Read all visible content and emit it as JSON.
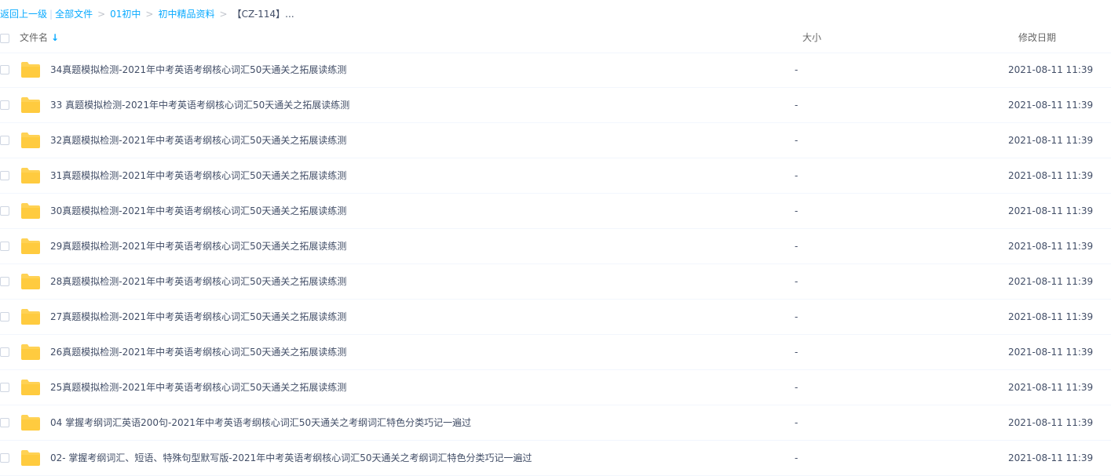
{
  "breadcrumb": {
    "back": "返回上一级",
    "bar": "|",
    "items": [
      "全部文件",
      "01初中",
      "初中精品资料"
    ],
    "gt": ">",
    "current": "【CZ-114】..."
  },
  "header": {
    "name": "文件名",
    "sort_icon": "↓",
    "size": "大小",
    "date": "修改日期"
  },
  "icons": {
    "folder": "folder-icon",
    "folder_color": "#ffd255"
  },
  "files": [
    {
      "name": "34真题模拟检测-2021年中考英语考纲核心词汇50天通关之拓展读练测",
      "size": "-",
      "date": "2021-08-11 11:39"
    },
    {
      "name": "33 真题模拟检测-2021年中考英语考纲核心词汇50天通关之拓展读练测",
      "size": "-",
      "date": "2021-08-11 11:39"
    },
    {
      "name": "32真题模拟检测-2021年中考英语考纲核心词汇50天通关之拓展读练测",
      "size": "-",
      "date": "2021-08-11 11:39"
    },
    {
      "name": "31真题模拟检测-2021年中考英语考纲核心词汇50天通关之拓展读练测",
      "size": "-",
      "date": "2021-08-11 11:39"
    },
    {
      "name": "30真题模拟检测-2021年中考英语考纲核心词汇50天通关之拓展读练测",
      "size": "-",
      "date": "2021-08-11 11:39"
    },
    {
      "name": "29真题模拟检测-2021年中考英语考纲核心词汇50天通关之拓展读练测",
      "size": "-",
      "date": "2021-08-11 11:39"
    },
    {
      "name": "28真题模拟检测-2021年中考英语考纲核心词汇50天通关之拓展读练测",
      "size": "-",
      "date": "2021-08-11 11:39"
    },
    {
      "name": "27真题模拟检测-2021年中考英语考纲核心词汇50天通关之拓展读练测",
      "size": "-",
      "date": "2021-08-11 11:39"
    },
    {
      "name": "26真题模拟检测-2021年中考英语考纲核心词汇50天通关之拓展读练测",
      "size": "-",
      "date": "2021-08-11 11:39"
    },
    {
      "name": "25真题模拟检测-2021年中考英语考纲核心词汇50天通关之拓展读练测",
      "size": "-",
      "date": "2021-08-11 11:39"
    },
    {
      "name": "04 掌握考纲词汇英语200句-2021年中考英语考纲核心词汇50天通关之考纲词汇特色分类巧记一遍过",
      "size": "-",
      "date": "2021-08-11 11:39"
    },
    {
      "name": "02- 掌握考纲词汇、短语、特殊句型默写版-2021年中考英语考纲核心词汇50天通关之考纲词汇特色分类巧记一遍过",
      "size": "-",
      "date": "2021-08-11 11:39"
    }
  ]
}
